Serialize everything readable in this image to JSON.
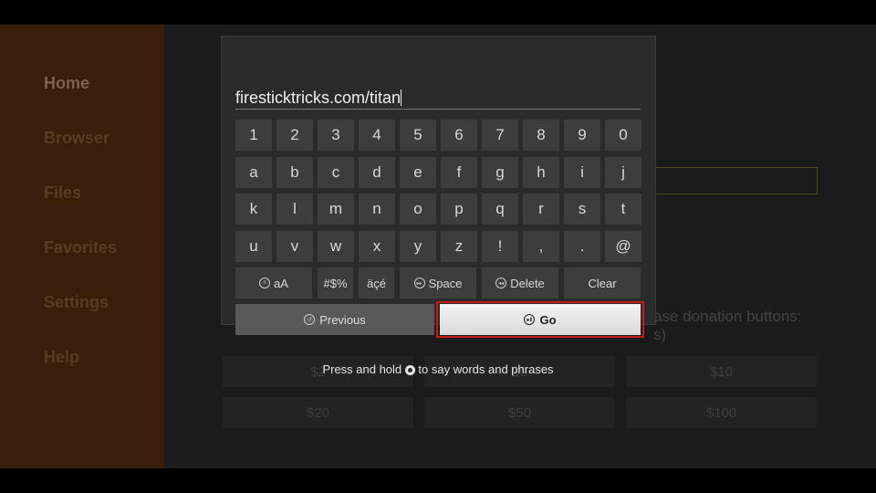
{
  "sidebar": {
    "items": [
      {
        "label": "Home",
        "active": true
      },
      {
        "label": "Browser"
      },
      {
        "label": "Files"
      },
      {
        "label": "Favorites"
      },
      {
        "label": "Settings"
      },
      {
        "label": "Help"
      }
    ]
  },
  "background": {
    "donation_text_line1": "ase donation buttons:",
    "donation_text_line2": "s)",
    "donations": [
      "$2",
      "$5",
      "$10",
      "$20",
      "$50",
      "$100"
    ]
  },
  "keyboard": {
    "input_value": "firesticktricks.com/titan",
    "rows": [
      [
        "1",
        "2",
        "3",
        "4",
        "5",
        "6",
        "7",
        "8",
        "9",
        "0"
      ],
      [
        "a",
        "b",
        "c",
        "d",
        "e",
        "f",
        "g",
        "h",
        "i",
        "j"
      ],
      [
        "k",
        "l",
        "m",
        "n",
        "o",
        "p",
        "q",
        "r",
        "s",
        "t"
      ],
      [
        "u",
        "v",
        "w",
        "x",
        "y",
        "z",
        "!",
        ",",
        ".",
        "@"
      ]
    ],
    "case_label": "aA",
    "symbols_label": "#$%",
    "accents_label": "äçé",
    "space_label": "Space",
    "delete_label": "Delete",
    "clear_label": "Clear",
    "previous_label": "Previous",
    "go_label": "Go",
    "hint_before": "Press and hold",
    "hint_after": "to say words and phrases",
    "focus_color": "#c41a1a"
  }
}
